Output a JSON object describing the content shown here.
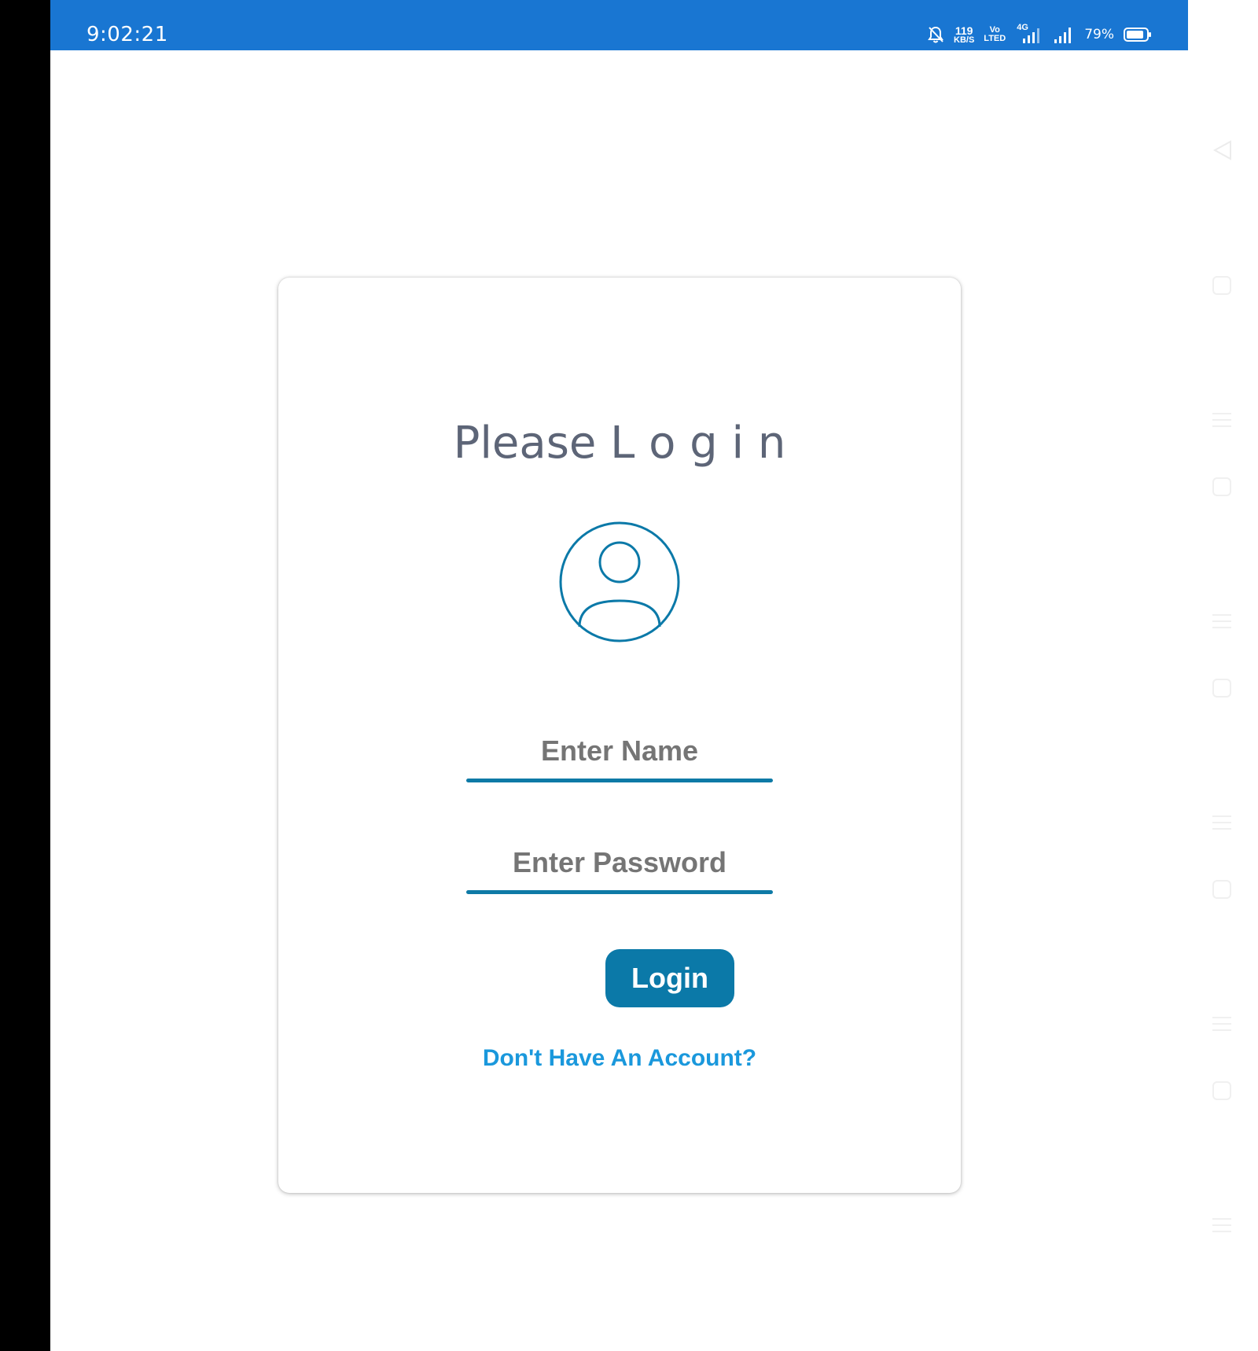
{
  "status_bar": {
    "time": "9:02:21",
    "net_speed_value": "119",
    "net_speed_unit": "KB/S",
    "volte_top": "Vo",
    "volte_bottom": "LTED",
    "network_type": "4G",
    "battery_percent": "79%",
    "background_color": "#1976d2"
  },
  "login_card": {
    "title": "Please L o g i n",
    "avatar_icon": "account-circle-icon",
    "name_field": {
      "placeholder": "Enter Name",
      "value": ""
    },
    "password_field": {
      "placeholder": "Enter Password",
      "value": ""
    },
    "login_button_label": "Login",
    "signup_link_label": "Don't Have An Account?",
    "accent_color": "#0b79a8",
    "link_color": "#1a98dc"
  }
}
